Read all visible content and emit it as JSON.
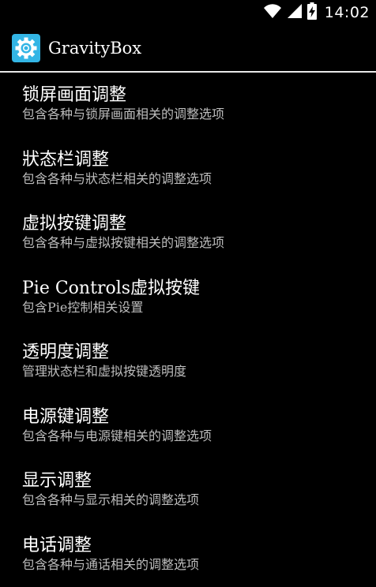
{
  "status_bar": {
    "time": "14:02",
    "icons": [
      "wifi-icon",
      "cell-signal-icon",
      "battery-charging-icon"
    ]
  },
  "action_bar": {
    "title": "GravityBox",
    "icon": "gear-icon",
    "accent": "#33b5e5"
  },
  "settings": {
    "items": [
      {
        "title": "锁屏画面调整",
        "summary": "包含各种与锁屏画面相关的调整选项"
      },
      {
        "title": "狀态栏调整",
        "summary": "包含各种与狀态栏相关的调整选项"
      },
      {
        "title": "虚拟按键调整",
        "summary": "包含各种与虚拟按键相关的调整选项"
      },
      {
        "title": "Pie Controls虚拟按键",
        "summary": "包含Pie控制相关设置"
      },
      {
        "title": "透明度调整",
        "summary": "管理狀态栏和虚拟按键透明度"
      },
      {
        "title": "电源键调整",
        "summary": "包含各种与电源键相关的调整选项"
      },
      {
        "title": "显示调整",
        "summary": "包含各种与显示相关的调整选项"
      },
      {
        "title": "电话调整",
        "summary": "包含各种与通话相关的调整选项"
      }
    ]
  }
}
